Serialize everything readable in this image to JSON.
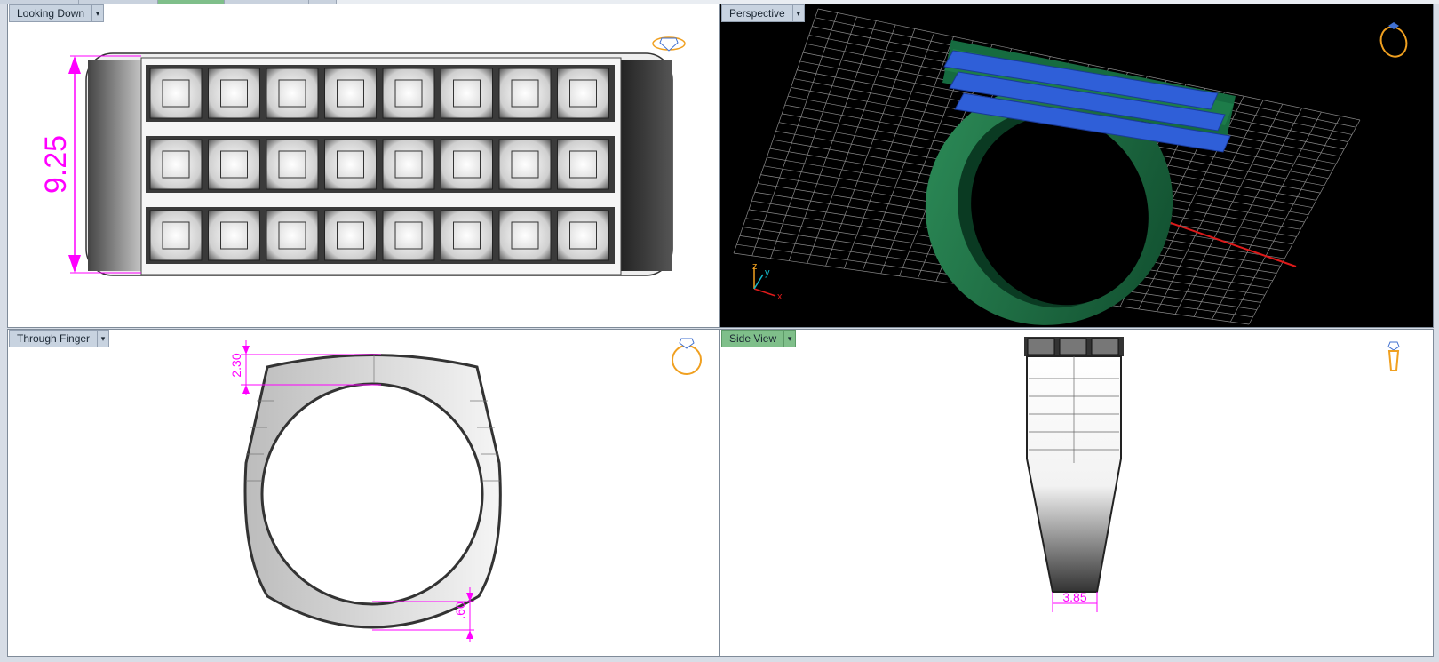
{
  "viewports": {
    "top_left": {
      "title": "Looking Down",
      "dimension": "9.25"
    },
    "top_right": {
      "title": "Perspective",
      "axes": {
        "x": "x",
        "y": "y",
        "z": "z"
      }
    },
    "bottom_left": {
      "title": "Through Finger",
      "dimensions": {
        "top": "2.30",
        "bottom": ".60"
      }
    },
    "bottom_right": {
      "title": "Side View",
      "dimension": "3.85"
    }
  },
  "icons": {
    "top_left": "ring-top-view-icon",
    "top_right": "ring-perspective-icon",
    "bottom_left": "ring-front-view-icon",
    "bottom_right": "ring-side-view-icon"
  },
  "colors": {
    "dimension": "#ff00ff",
    "ring_metal": "#1f7a4a",
    "gems": "#2f5fd8",
    "icon": "#f0a020",
    "active_tab": "#7fbf8a"
  },
  "menu_glyph": "▾"
}
